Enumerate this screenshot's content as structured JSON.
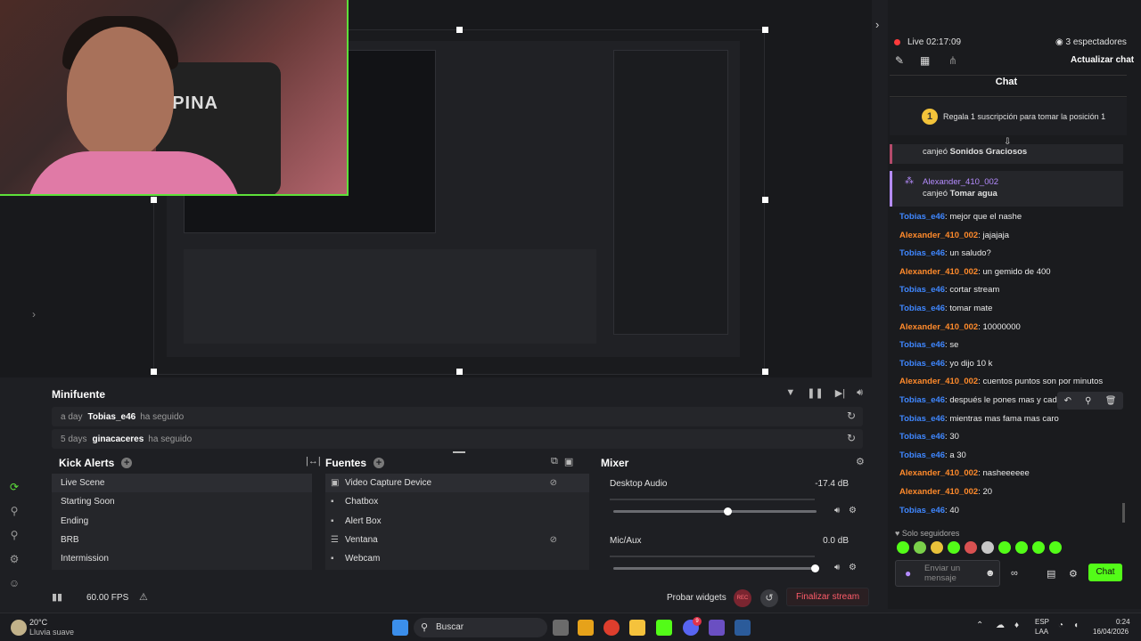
{
  "window": {
    "min": "—",
    "max": "☐",
    "close": "✕"
  },
  "webcam": {
    "chair_text": "LPINA"
  },
  "minifuente": {
    "title": "Minifuente",
    "rows": [
      {
        "time": "a day",
        "user": "Tobias_e46",
        "text": "ha seguido"
      },
      {
        "time": "5 days",
        "user": "ginacaceres",
        "text": "ha seguido"
      }
    ]
  },
  "kick_alerts": {
    "title": "Kick Alerts",
    "items": [
      "Live Scene",
      "Starting Soon",
      "Ending",
      "BRB",
      "Intermission"
    ]
  },
  "fuentes": {
    "title": "Fuentes",
    "items": [
      "Video Capture Device",
      "Chatbox",
      "Alert Box",
      "Ventana",
      "Webcam"
    ]
  },
  "mixer": {
    "title": "Mixer",
    "tracks": [
      {
        "name": "Desktop Audio",
        "db": "-17.4 dB",
        "level": 0.56
      },
      {
        "name": "Mic/Aux",
        "db": "0.0 dB",
        "level": 1.0
      }
    ]
  },
  "statusbar": {
    "fps": "60.00 FPS",
    "probar": "Probar widgets",
    "rec": "REC",
    "finalizar": "Finalizar stream"
  },
  "chat_panel": {
    "live_label": "Live",
    "live_time": "02:17:09",
    "viewers": "3 espectadores",
    "actualizar": "Actualizar chat",
    "title": "Chat",
    "gift_num": "1",
    "gift_text": "Regala 1 suscripción para tomar la posición 1",
    "redeem1_prefix": "canjeó",
    "redeem1_item": "Sonidos Graciosos",
    "redeem2_user": "Alexander_410_002",
    "redeem2_prefix": "canjeó",
    "redeem2_item": "Tomar agua",
    "messages": [
      {
        "user": "Tobias_e46",
        "color": "blue",
        "text": "mejor que el nashe"
      },
      {
        "user": "Alexander_410_002",
        "color": "orange",
        "text": "jajajaja"
      },
      {
        "user": "Tobias_e46",
        "color": "blue",
        "text": "un saludo?"
      },
      {
        "user": "Alexander_410_002",
        "color": "orange",
        "text": "un gemido de 400"
      },
      {
        "user": "Tobias_e46",
        "color": "blue",
        "text": "cortar stream"
      },
      {
        "user": "Tobias_e46",
        "color": "blue",
        "text": "tomar mate"
      },
      {
        "user": "Alexander_410_002",
        "color": "orange",
        "text": "10000000"
      },
      {
        "user": "Tobias_e46",
        "color": "blue",
        "text": "se"
      },
      {
        "user": "Tobias_e46",
        "color": "blue",
        "text": "yo dijo 10 k"
      },
      {
        "user": "Alexander_410_002",
        "color": "orange",
        "text": "cuentos puntos son por minutos"
      },
      {
        "user": "Tobias_e46",
        "color": "blue",
        "text": "después le pones mas y cada"
      },
      {
        "user": "Tobias_e46",
        "color": "blue",
        "text": "mientras mas fama mas caro"
      },
      {
        "user": "Tobias_e46",
        "color": "blue",
        "text": "30"
      },
      {
        "user": "Tobias_e46",
        "color": "blue",
        "text": "a 30"
      },
      {
        "user": "Alexander_410_002",
        "color": "orange",
        "text": "nasheeeeee"
      },
      {
        "user": "Alexander_410_002",
        "color": "orange",
        "text": "20"
      },
      {
        "user": "Tobias_e46",
        "color": "blue",
        "text": "40"
      }
    ],
    "solo_seguidores": "Solo seguidores",
    "input_placeholder": "Enviar un mensaje",
    "send": "Chat"
  },
  "taskbar": {
    "weather_temp": "20°C",
    "weather_desc": "Lluvia suave",
    "search": "Buscar",
    "lang1": "ESP",
    "lang2": "LAA",
    "time": "0:24",
    "date": "16/04/2026",
    "discord_badge": "9"
  },
  "colors": {
    "accent_green": "#53fc18",
    "finalizar_red": "#ff5c6a",
    "blue_user": "#3f87ff",
    "orange_user": "#ff8a2b"
  }
}
